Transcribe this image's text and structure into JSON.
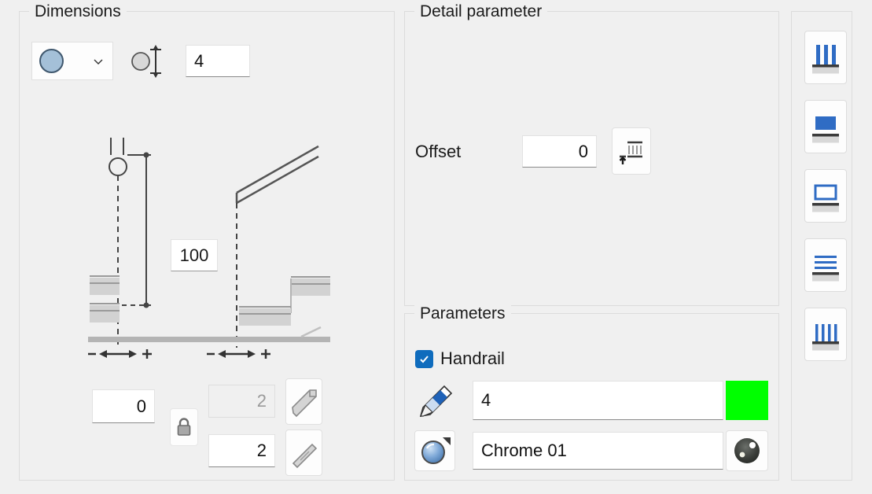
{
  "groups": {
    "dimensions": {
      "legend": "Dimensions"
    },
    "detail": {
      "legend": "Detail parameter"
    },
    "parameters": {
      "legend": "Parameters"
    }
  },
  "dimensions": {
    "shape_select": {
      "name": "profile-shape-select",
      "value_icon": "circle-profile-swatch",
      "chevron": "chevron-down-icon"
    },
    "diameter_icon": "diameter-dimension-icon",
    "diameter_value": "4",
    "drawing": {
      "name": "stair-handrail-section-drawing",
      "dimension_value": "100",
      "left_marker": "-",
      "left_marker_plus": "+",
      "right_marker": "-",
      "right_marker_plus": "+"
    },
    "angle_a_value": "0",
    "lock_icon": "lock-closed-icon",
    "angle_b_value": "2",
    "angle_c_value": "2",
    "slope_button_icon": "sloped-rail-icon",
    "flat_button_icon": "straight-rail-icon"
  },
  "detail": {
    "offset_label": "Offset",
    "offset_value": "0",
    "offset_button_icon": "offset-from-base-icon"
  },
  "parameters": {
    "handrail_checkbox": {
      "label": "Handrail",
      "checked": true,
      "icon": "check-icon"
    },
    "pencil_icon": "pencil-icon",
    "rail_size_value": "4",
    "color_swatch": "#00ff00",
    "material_button_icon": "material-sphere-icon",
    "material_value": "Chrome 01",
    "chrome_preview_icon": "chrome-sphere-icon"
  },
  "toolbar": {
    "items": [
      {
        "name": "balusters-vertical-icon",
        "label": "Vertical balusters"
      },
      {
        "name": "solid-panel-icon",
        "label": "Solid panel"
      },
      {
        "name": "frame-panel-icon",
        "label": "Frame panel"
      },
      {
        "name": "horizontal-rails-icon",
        "label": "Horizontal rails"
      },
      {
        "name": "narrow-balusters-icon",
        "label": "Narrow balusters"
      }
    ]
  },
  "colors": {
    "accent": "#0f6cbd",
    "background": "#f0f0f0",
    "field_background": "#ffffff",
    "profile_swatch": "#a4c0d8",
    "green": "#00ff00"
  }
}
